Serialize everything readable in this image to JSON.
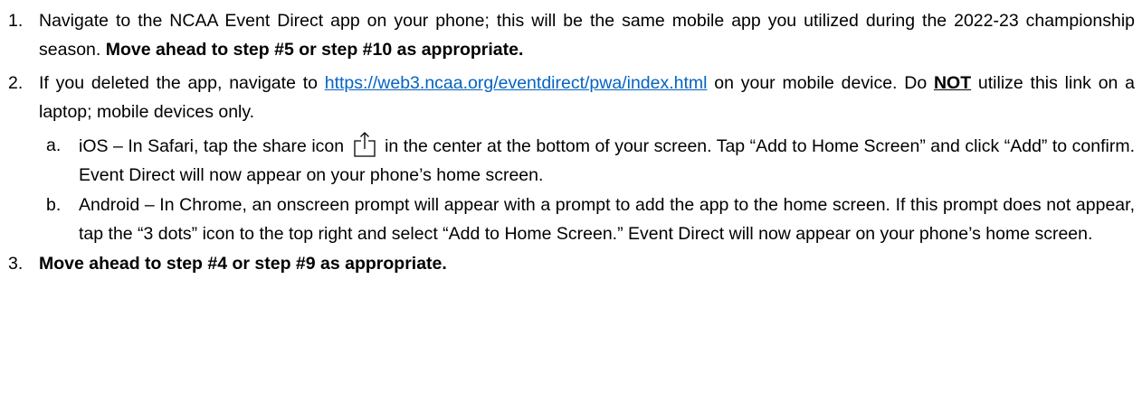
{
  "steps": [
    {
      "number": "1.",
      "text": "Navigate to the NCAA Event Direct app on your phone; this will be the same mobile app you utilized during the 2022-23 championship season.",
      "bold": "Move ahead to step #5 or step #10 as appropriate."
    },
    {
      "number": "2.",
      "text_before_link": "If you deleted the app, navigate to",
      "link": "https://web3.ncaa.org/eventdirect/pwa/index.html",
      "text_after_link": "on your mobile device. Do",
      "emphasis": "NOT",
      "text_after_emphasis": "utilize this link on a laptop; mobile devices only.",
      "substeps": [
        {
          "letter": "a.",
          "text_before_icon": "iOS – In Safari, tap the share icon",
          "text_after_icon": "in the center at the bottom of your screen. Tap “Add to Home Screen” and click “Add” to confirm. Event Direct will now appear on your phone’s home screen."
        },
        {
          "letter": "b.",
          "text": "Android – In Chrome, an onscreen prompt will appear with a prompt to add the app to the home screen. If this prompt does not appear, tap the “3 dots” icon to the top right and select “Add to Home Screen.” Event Direct will now appear on your phone’s home screen."
        }
      ]
    },
    {
      "number": "3.",
      "bold": "Move ahead to step #4 or step #9 as appropriate."
    }
  ],
  "colors": {
    "text": "#000000",
    "link": "#0563c1"
  },
  "icons": {
    "share": "share-icon"
  }
}
